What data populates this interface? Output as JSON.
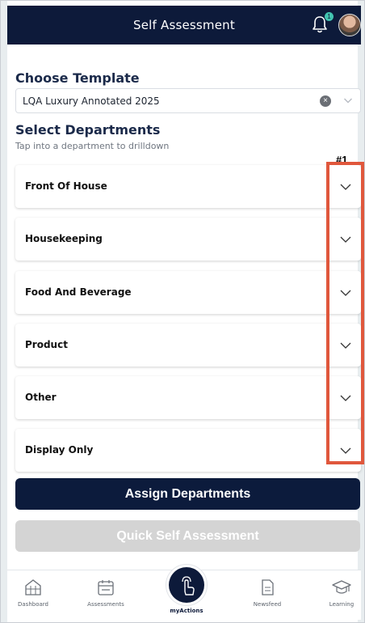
{
  "header": {
    "title": "Self Assessment",
    "notification_count": "1"
  },
  "template": {
    "label": "Choose Template",
    "selected": "LQA Luxury Annotated 2025",
    "clear_symbol": "×"
  },
  "departments": {
    "label": "Select Departments",
    "hint": "Tap into a department to drilldown",
    "items": [
      {
        "label": "Front Of House"
      },
      {
        "label": "Housekeeping"
      },
      {
        "label": "Food And Beverage"
      },
      {
        "label": "Product"
      },
      {
        "label": "Other"
      },
      {
        "label": "Display Only"
      }
    ]
  },
  "annotation": {
    "label": "#1",
    "color": "#e0573c"
  },
  "actions": {
    "assign": "Assign Departments",
    "quick": "Quick Self Assessment"
  },
  "nav": {
    "items": [
      {
        "label": "Dashboard",
        "icon": "dashboard-icon"
      },
      {
        "label": "Assessments",
        "icon": "calendar-icon"
      },
      {
        "label": "myActions",
        "icon": "tap-icon"
      },
      {
        "label": "Newsfeed",
        "icon": "document-icon"
      },
      {
        "label": "Learning",
        "icon": "graduation-cap-icon"
      }
    ]
  },
  "colors": {
    "navy": "#0d1a3a",
    "badge": "#42c3b0",
    "disabled": "#d4d4d4"
  }
}
